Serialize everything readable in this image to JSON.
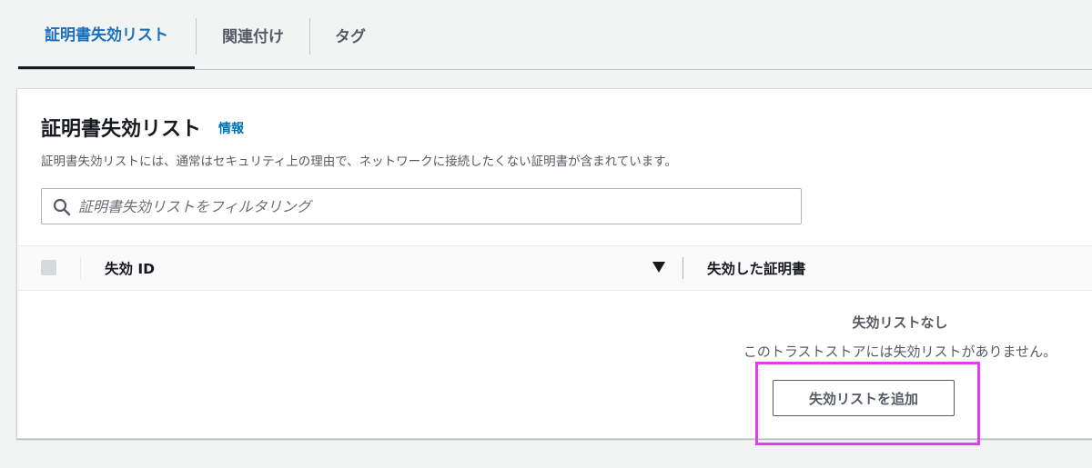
{
  "tabs": [
    {
      "label": "証明書失効リスト",
      "active": true
    },
    {
      "label": "関連付け",
      "active": false
    },
    {
      "label": "タグ",
      "active": false
    }
  ],
  "panel": {
    "title": "証明書失効リスト",
    "info_link": "情報",
    "description": "証明書失効リストには、通常はセキュリティ上の理由で、ネットワークに接続したくない証明書が含まれています。"
  },
  "search": {
    "placeholder": "証明書失効リストをフィルタリング",
    "value": "",
    "icon": "search-icon"
  },
  "table": {
    "columns": [
      {
        "label": "失効 ID",
        "sortable": true,
        "sort_icon": "caret-down-icon"
      },
      {
        "label": "失効した証明書"
      }
    ],
    "rows": []
  },
  "empty_state": {
    "title": "失効リストなし",
    "description": "このトラストストアには失効リストがありません。",
    "button_label": "失効リストを追加"
  },
  "colors": {
    "active_tab": "#1a6fbf",
    "link": "#0073bb",
    "highlight_box": "#e040e8",
    "background": "#f2f3f3"
  }
}
